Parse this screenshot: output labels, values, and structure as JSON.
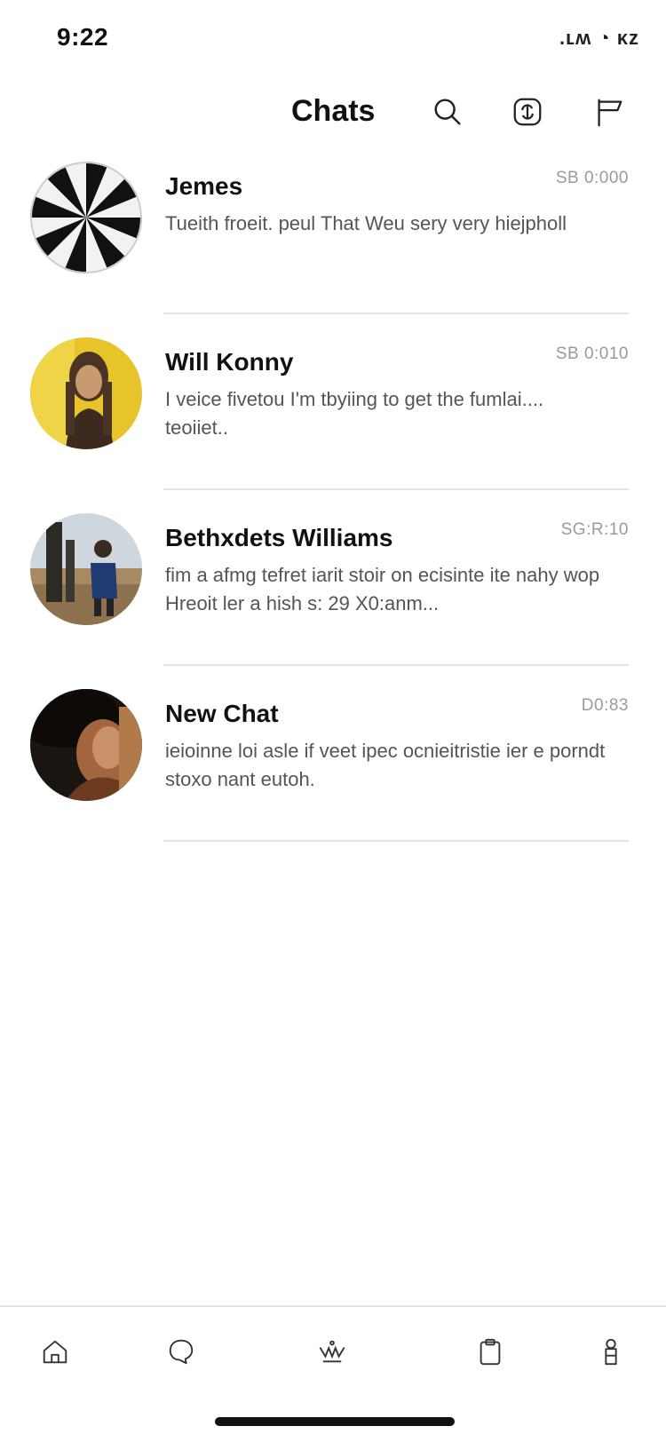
{
  "status_bar": {
    "time": "9:22",
    "icons_text": ".ʟʍ ◔ ᴋᴢ"
  },
  "header": {
    "title": "Chats",
    "icons": [
      "search-icon",
      "new-chat-icon",
      "flag-icon"
    ]
  },
  "chats": [
    {
      "name": "Jemes",
      "time": "SB 0:000",
      "preview": "Tueith froeit. peul That Weu sery very hiejpholl",
      "avatar": "radial-stripes-avatar"
    },
    {
      "name": "Will Konny",
      "time": "SB 0:010",
      "preview": "I veice fivetou I'm tbyiing to get the fumlai.... teoiiet..",
      "avatar": "woman-yellow-portrait-avatar"
    },
    {
      "name": "Bethxdets Williams",
      "time": "SG:R:10",
      "preview": "fim a afmg tefret iarit stoir on ecisinte ite nahy wop Hreoit ler a hish s: 29 X0:anm...",
      "avatar": "desert-person-avatar"
    },
    {
      "name": "New Chat",
      "time": "D0:83",
      "preview": "ieioinne loi asle if veet ipec ocnieitristie ier e porndt stoxo nant eutoh.",
      "avatar": "man-hat-portrait-avatar"
    }
  ],
  "tab_bar": {
    "tabs": [
      "home-icon",
      "chat-bubble-icon",
      "discover-icon",
      "clipboard-icon",
      "profile-icon"
    ]
  },
  "colors": {
    "background": "#ffffff",
    "text_primary": "#111111",
    "text_secondary": "#555555",
    "timestamp": "#9a9a9a",
    "divider": "#e3e3e3"
  }
}
